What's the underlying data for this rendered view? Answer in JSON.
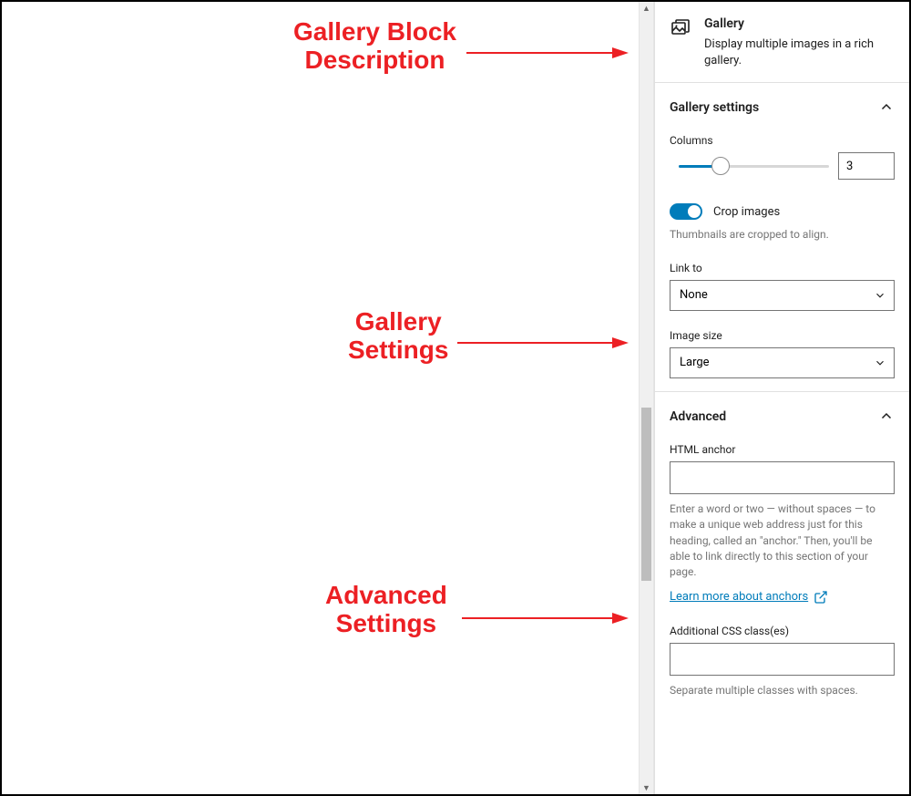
{
  "annotations": {
    "desc": "Gallery Block\nDescription",
    "settings": "Gallery\nSettings",
    "advanced": "Advanced\nSettings"
  },
  "block": {
    "name": "Gallery",
    "description": "Display multiple images in a rich gallery."
  },
  "gallery_settings": {
    "title": "Gallery settings",
    "columns_label": "Columns",
    "columns_value": "3",
    "crop_label": "Crop images",
    "crop_on": true,
    "crop_helper": "Thumbnails are cropped to align.",
    "link_to_label": "Link to",
    "link_to_value": "None",
    "image_size_label": "Image size",
    "image_size_value": "Large"
  },
  "advanced": {
    "title": "Advanced",
    "anchor_label": "HTML anchor",
    "anchor_value": "",
    "anchor_help": "Enter a word or two — without spaces — to make a unique web address just for this heading, called an \"anchor.\" Then, you'll be able to link directly to this section of your page.",
    "anchor_link_text": "Learn more about anchors",
    "css_label": "Additional CSS class(es)",
    "css_value": "",
    "css_help": "Separate multiple classes with spaces."
  }
}
